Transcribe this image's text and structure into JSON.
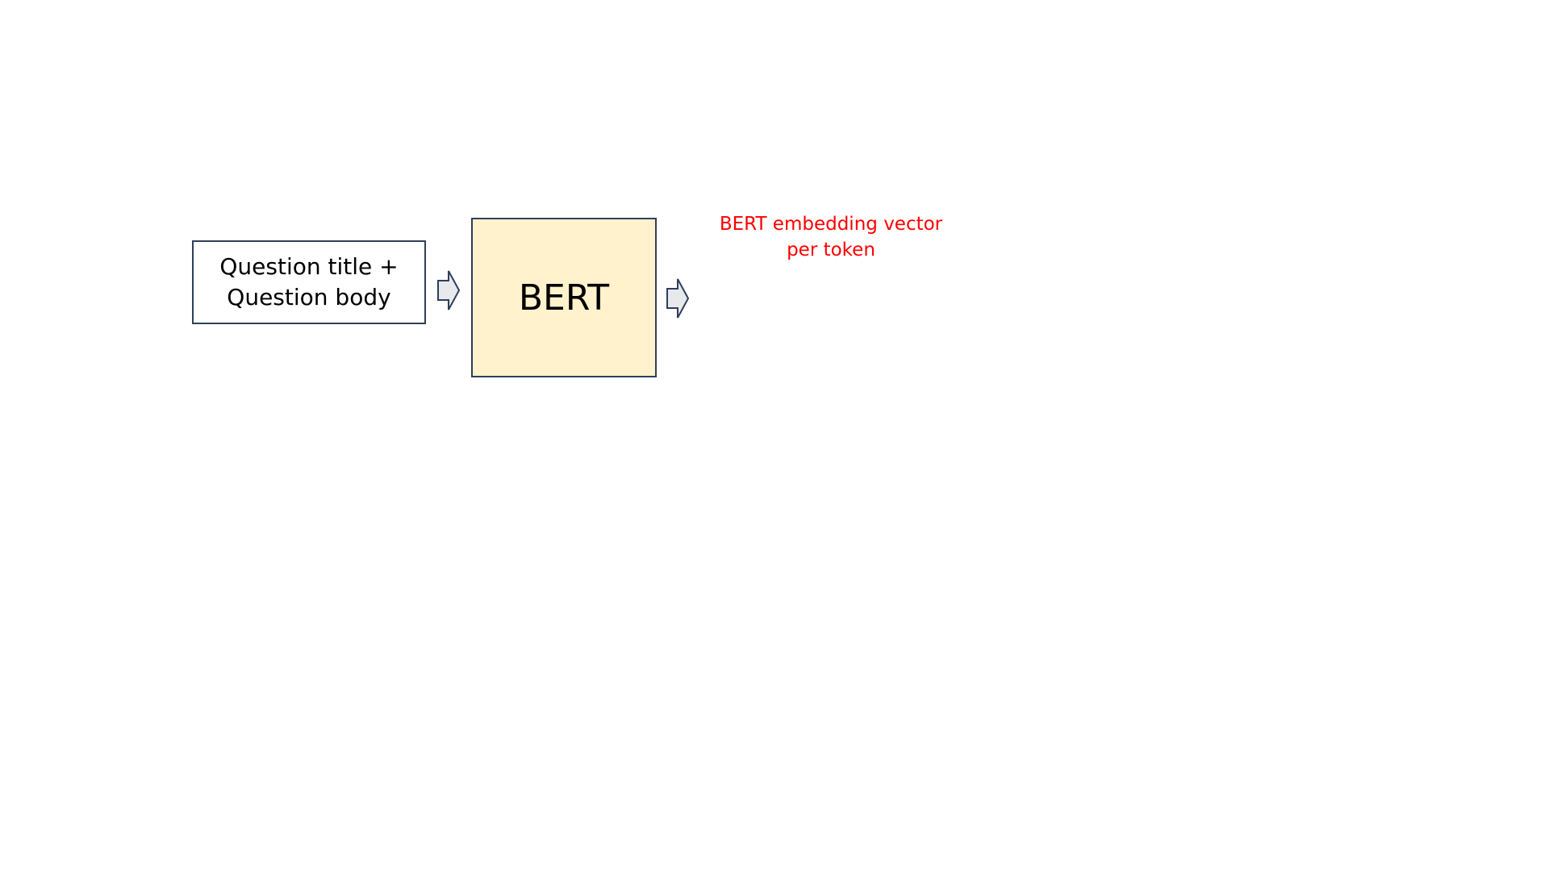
{
  "input_block": {
    "line1": "Question title +",
    "line2": "Question body"
  },
  "model_block": {
    "label": "BERT",
    "fill_color": "#fff2cc"
  },
  "output_label": {
    "line1": "BERT embedding vector",
    "line2": "per token",
    "color": "#ff0000"
  },
  "arrows": [
    {
      "name": "input-to-bert-arrow",
      "icon": "right-arrow-icon"
    },
    {
      "name": "bert-to-output-arrow",
      "icon": "right-arrow-icon"
    }
  ],
  "colors": {
    "border": "#2f3f5a",
    "arrow_fill": "#e8e9ec"
  }
}
